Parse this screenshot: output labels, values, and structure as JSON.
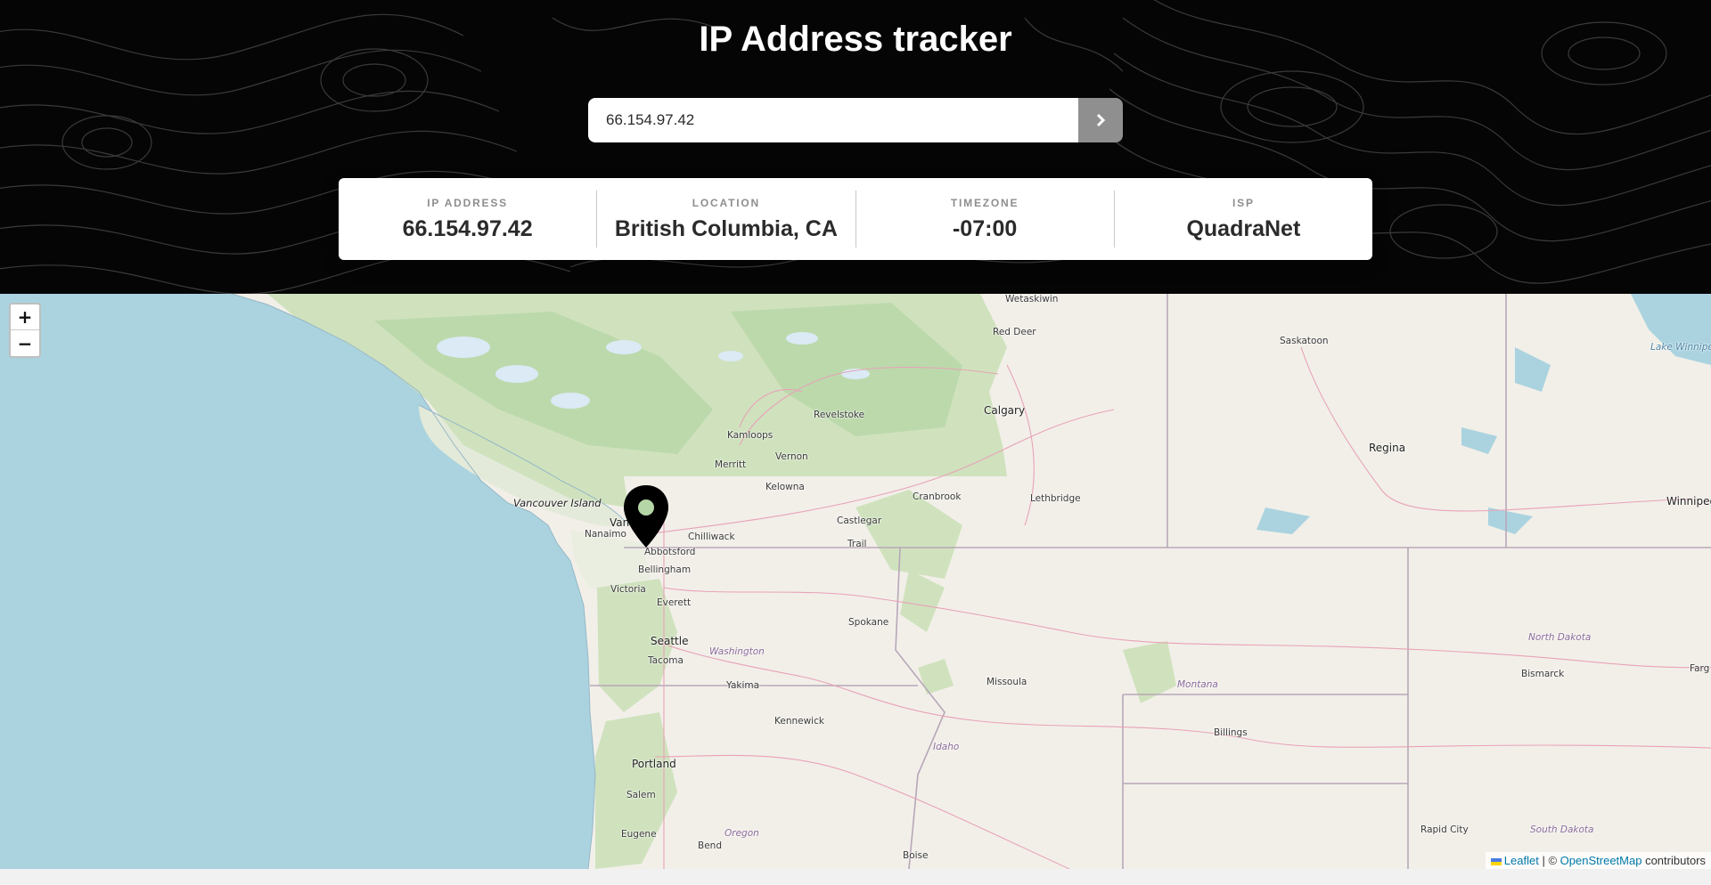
{
  "header": {
    "title": "IP Address tracker"
  },
  "search": {
    "value": "66.154.97.42",
    "submit_icon": "chevron-right-icon"
  },
  "info": {
    "ip_label": "IP ADDRESS",
    "ip_value": "66.154.97.42",
    "location_label": "LOCATION",
    "location_value": "British Columbia, CA",
    "timezone_label": "TIMEZONE",
    "timezone_value": "-07:00",
    "isp_label": "ISP",
    "isp_value": "QuadraNet"
  },
  "map": {
    "zoom_in": "+",
    "zoom_out": "−",
    "marker_icon": "location-pin-icon",
    "places": {
      "wetaskiwin": "Wetaskiwin",
      "red_deer": "Red Deer",
      "saskatoon": "Saskatoon",
      "lake_winnipeg": "Lake Winnipeg",
      "revelstoke": "Revelstoke",
      "calgary": "Calgary",
      "kamloops": "Kamloops",
      "regina": "Regina",
      "vernon": "Vernon",
      "merritt": "Merritt",
      "kelowna": "Kelowna",
      "cranbrook": "Cranbrook",
      "lethbridge": "Lethbridge",
      "winnipeg": "Winnipeg",
      "vancouver_island": "Vancouver Island",
      "vancouver": "Van",
      "castlegar": "Castlegar",
      "nanaimo": "Nanaimo",
      "chilliwack": "Chilliwack",
      "abbotsford": "Abbotsford",
      "trail": "Trail",
      "bellingham": "Bellingham",
      "victoria": "Victoria",
      "everett": "Everett",
      "spokane": "Spokane",
      "seattle": "Seattle",
      "washington": "Washington",
      "north_dakota": "North Dakota",
      "fargo": "Farg",
      "tacoma": "Tacoma",
      "missoula": "Missoula",
      "bismarck": "Bismarck",
      "montana": "Montana",
      "yakima": "Yakima",
      "kennewick": "Kennewick",
      "billings": "Billings",
      "idaho": "Idaho",
      "portland": "Portland",
      "salem": "Salem",
      "eugene": "Eugene",
      "oregon": "Oregon",
      "bend": "Bend",
      "rapid_city": "Rapid City",
      "south_dakota": "South Dakota",
      "boise": "Boise"
    }
  },
  "attribution": {
    "leaflet": "Leaflet",
    "separator": "| ©",
    "osm": "OpenStreetMap",
    "contributors": "contributors"
  }
}
